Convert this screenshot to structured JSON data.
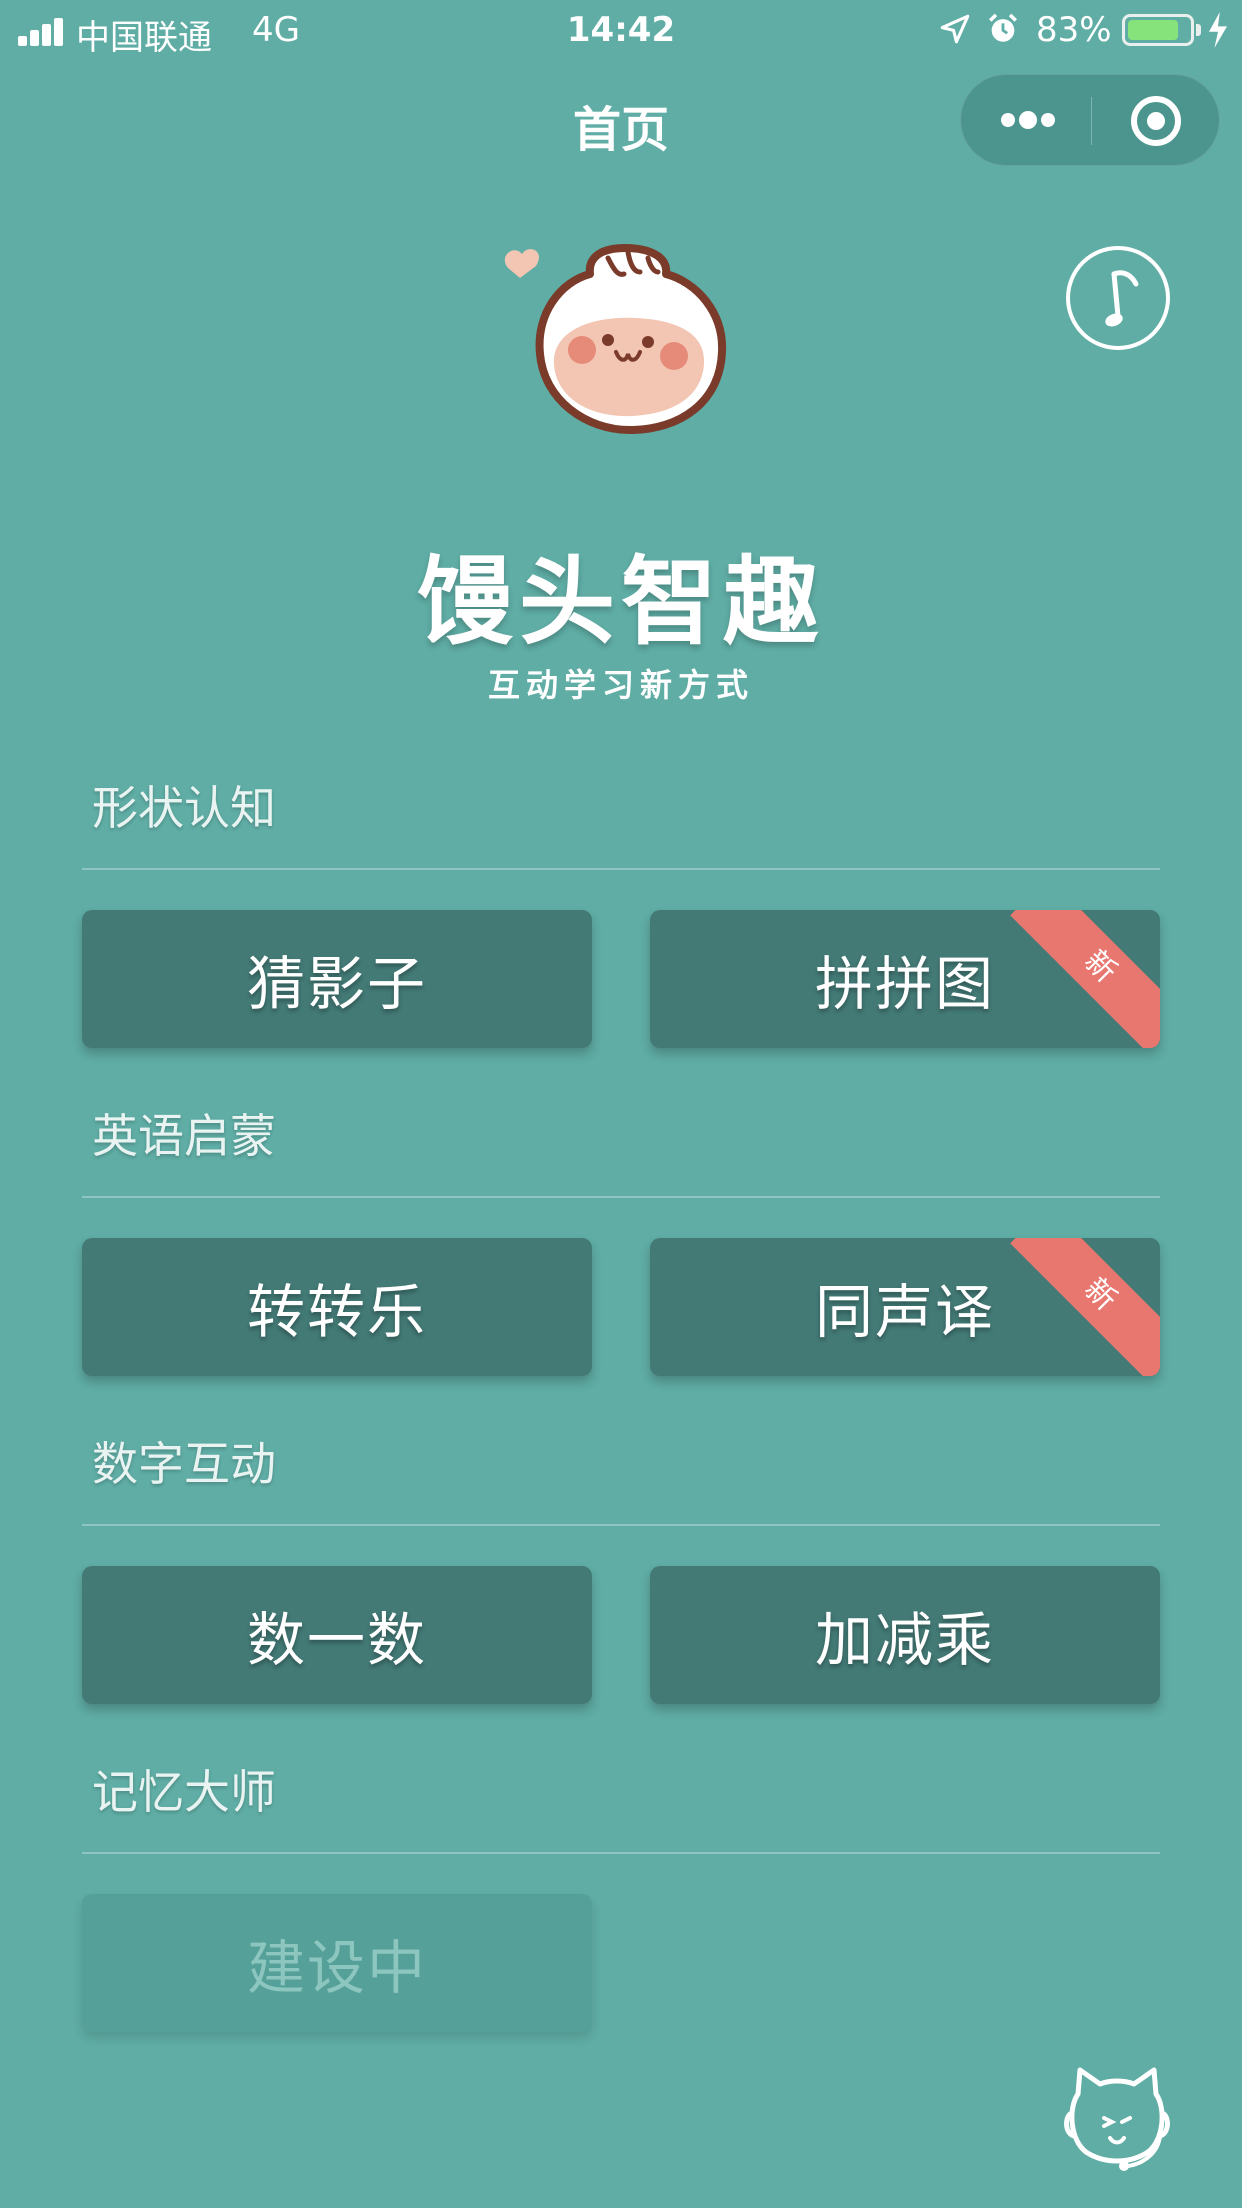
{
  "status_bar": {
    "carrier": "中国联通",
    "network": "4G",
    "time": "14:42",
    "battery_percent": "83%",
    "battery_level": 0.83
  },
  "nav": {
    "title": "首页"
  },
  "logo": {
    "title": "馒头智趣",
    "subtitle": "互动学习新方式"
  },
  "sections": [
    {
      "title": "形状认知",
      "buttons": [
        {
          "label": "猜影子",
          "badge": ""
        },
        {
          "label": "拼拼图",
          "badge": "新"
        }
      ]
    },
    {
      "title": "英语启蒙",
      "buttons": [
        {
          "label": "转转乐",
          "badge": ""
        },
        {
          "label": "同声译",
          "badge": "新"
        }
      ]
    },
    {
      "title": "数字互动",
      "buttons": [
        {
          "label": "数一数",
          "badge": ""
        },
        {
          "label": "加减乘",
          "badge": ""
        }
      ]
    },
    {
      "title": "记忆大师",
      "buttons": [
        {
          "label": "建设中",
          "badge": "",
          "disabled": true
        }
      ]
    }
  ],
  "colors": {
    "background": "#5fada5",
    "button": "#437a76",
    "button_disabled": "#56a09a",
    "ribbon": "#e8786f"
  },
  "icons": {
    "music": "music-note-icon",
    "mascot": "cat-headset-icon",
    "more": "more-dots-icon",
    "close": "target-circle-icon"
  }
}
